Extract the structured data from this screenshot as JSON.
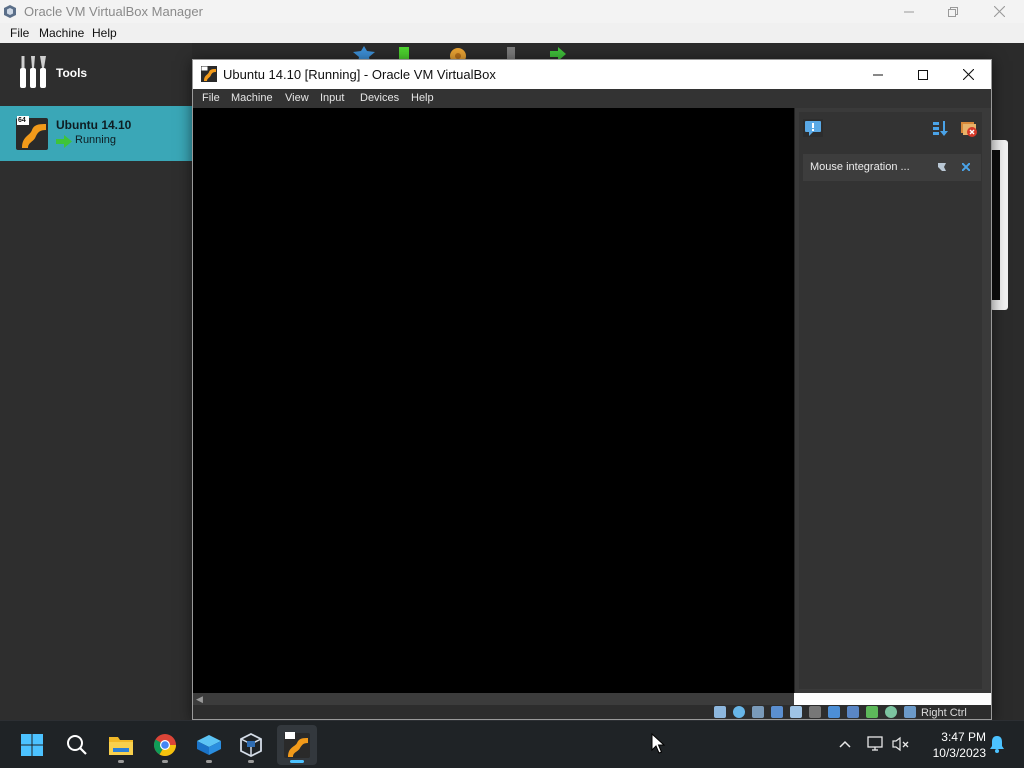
{
  "manager": {
    "title": "Oracle VM VirtualBox Manager",
    "menu": [
      "File",
      "Machine",
      "Help"
    ],
    "sidebar": {
      "tools_label": "Tools",
      "vm_name": "Ubuntu 14.10",
      "vm_state": "Running",
      "vm_badge": "64"
    }
  },
  "vm_window": {
    "title": "Ubuntu 14.10 [Running] - Oracle VM VirtualBox",
    "menu": [
      "File",
      "Machine",
      "View",
      "Input",
      "Devices",
      "Help"
    ],
    "notification": {
      "text": "Mouse integration ..."
    },
    "status_bar": {
      "host_key": "Right Ctrl"
    }
  },
  "taskbar": {
    "time": "3:47 PM",
    "date": "10/3/2023"
  },
  "colors": {
    "selection": "#3aa7b7",
    "accent": "#4cc2ff",
    "vm_screen": "#000000"
  }
}
